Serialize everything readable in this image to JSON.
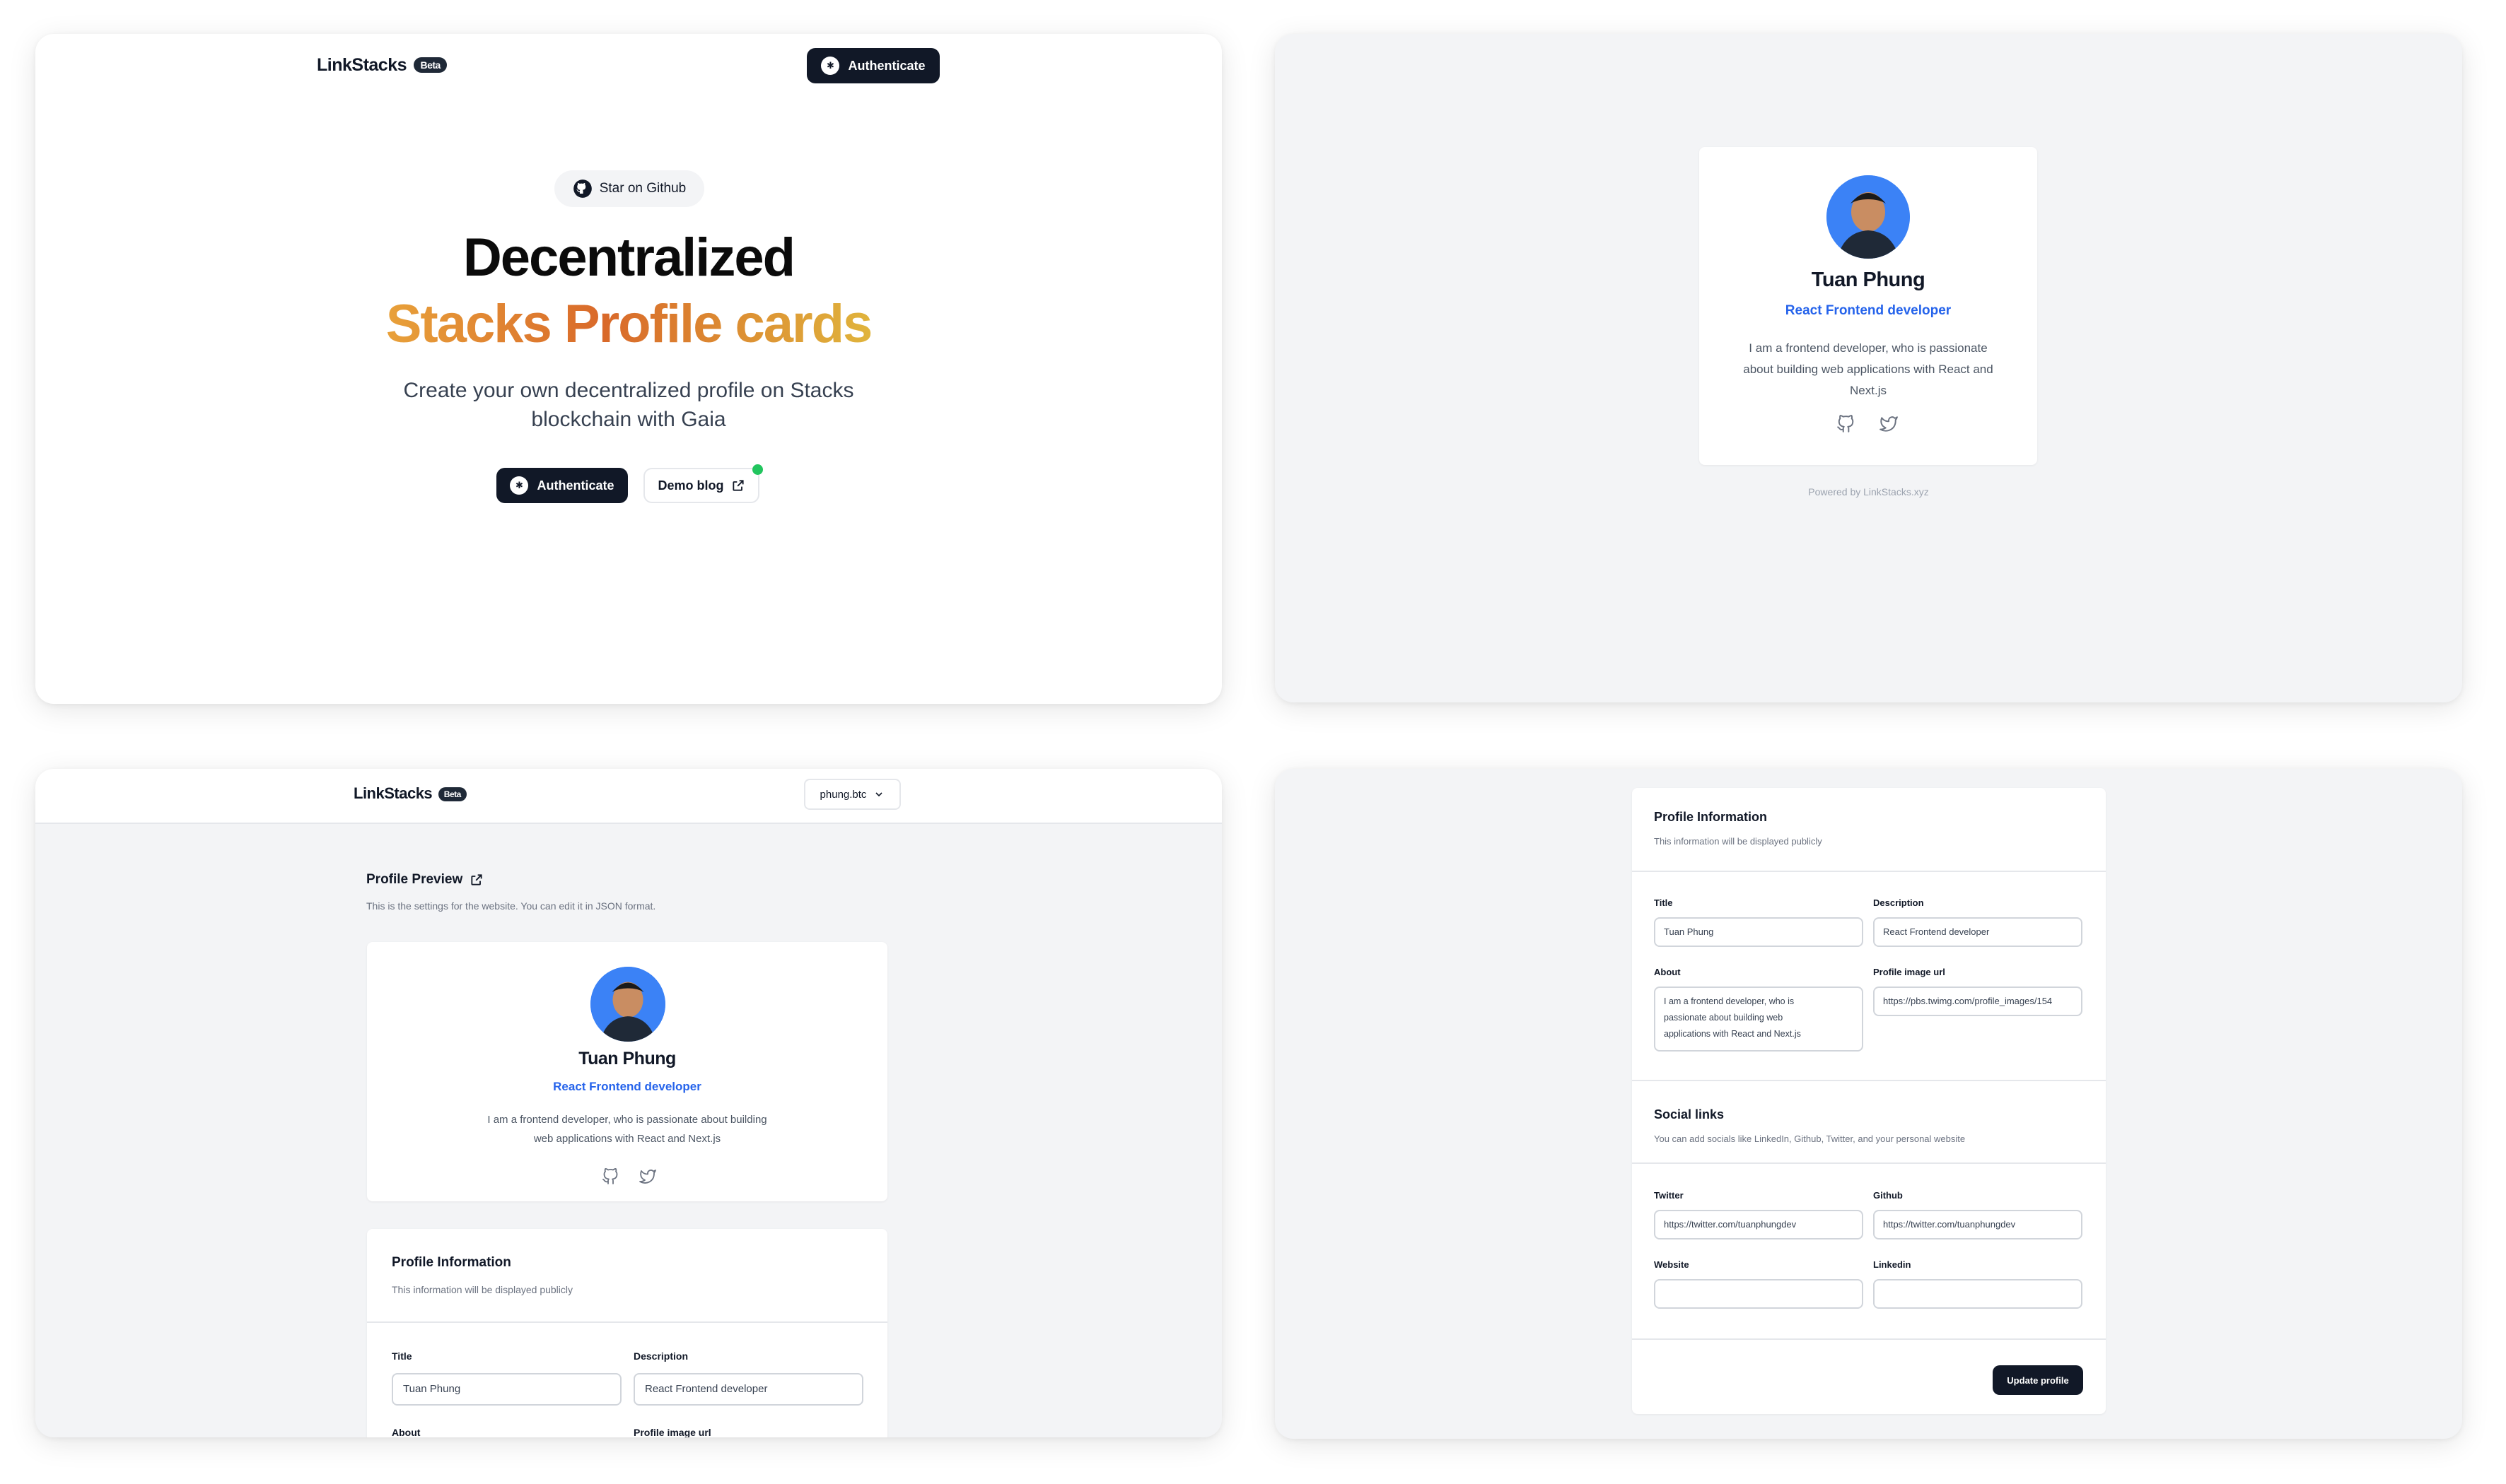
{
  "landing": {
    "brand": "LinkStacks",
    "beta": "Beta",
    "nav_auth": "Authenticate",
    "github_pill": "Star on Github",
    "headline_1": "Decentralized",
    "headline_2": "Stacks Profile cards",
    "subtitle_1": "Create your own decentralized profile on Stacks",
    "subtitle_2": "blockchain with Gaia",
    "cta_auth": "Authenticate",
    "cta_demo": "Demo blog",
    "status_color": "#22c55e",
    "gradient": [
      "#e8a13a",
      "#d9692a",
      "#e0b43c"
    ]
  },
  "profile_card": {
    "name": "Tuan Phung",
    "role": "React Frontend developer",
    "about": "I am a frontend developer, who is passionate about building web applications with React and Next.js",
    "about_lines_wide": [
      "I am a frontend developer, who is passionate",
      "about building web applications with React and",
      "Next.js"
    ],
    "about_lines_preview": [
      "I am a frontend developer, who is passionate about building",
      "web applications with React and Next.js"
    ],
    "powered_by": "Powered by LinkStacks.xyz",
    "icons": [
      "github-icon",
      "twitter-icon"
    ],
    "accent": "#2563eb"
  },
  "dashboard": {
    "brand": "LinkStacks",
    "beta": "Beta",
    "account": "phung.btc",
    "preview_title": "Profile Preview",
    "preview_subtitle": "This is the settings for the website. You can edit it in JSON format."
  },
  "form": {
    "info_title": "Profile Information",
    "info_subtitle": "This information will be displayed publicly",
    "title_label": "Title",
    "title_value": "Tuan Phung",
    "description_label": "Description",
    "description_value": "React Frontend developer",
    "about_label": "About",
    "about_lines": [
      "I am a frontend developer, who is",
      "passionate about building web",
      "applications with React and Next.js"
    ],
    "image_label": "Profile image url",
    "image_value": "https://pbs.twimg.com/profile_images/154",
    "social_title": "Social links",
    "social_subtitle": "You can add socials like LinkedIn, Github, Twitter, and your personal website",
    "twitter_label": "Twitter",
    "twitter_value": "https://twitter.com/tuanphungdev",
    "github_label": "Github",
    "github_value": "https://twitter.com/tuanphungdev",
    "website_label": "Website",
    "website_value": "",
    "linkedin_label": "Linkedin",
    "linkedin_value": "",
    "submit": "Update profile"
  }
}
